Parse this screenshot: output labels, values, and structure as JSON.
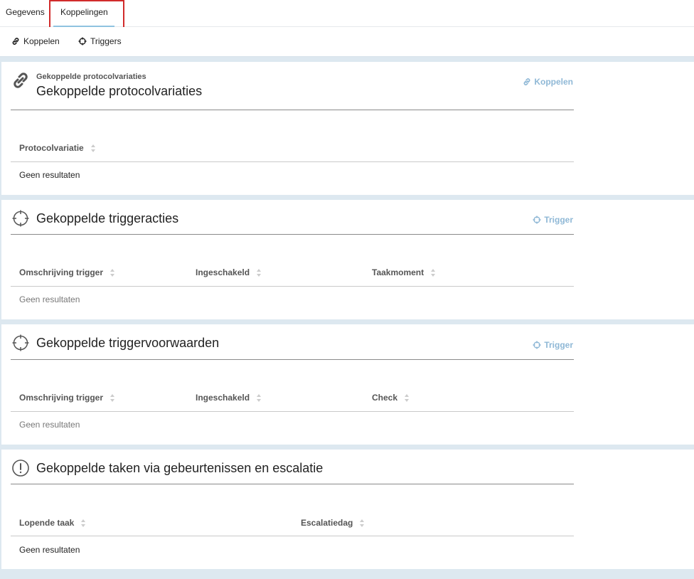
{
  "tabs": {
    "gegevens": "Gegevens",
    "koppelingen": "Koppelingen"
  },
  "toolbar": {
    "koppelen": "Koppelen",
    "triggers": "Triggers"
  },
  "panels": {
    "protocol": {
      "subtitle": "Gekoppelde protocolvariaties",
      "title": "Gekoppelde protocolvariaties",
      "action": "Koppelen",
      "columns": [
        "Protocolvariatie"
      ],
      "empty": "Geen resultaten"
    },
    "triggeracties": {
      "title": "Gekoppelde triggeracties",
      "action": "Trigger",
      "columns": [
        "Omschrijving trigger",
        "Ingeschakeld",
        "Taakmoment"
      ],
      "empty": "Geen resultaten"
    },
    "triggervoorwaarden": {
      "title": "Gekoppelde triggervoorwaarden",
      "action": "Trigger",
      "columns": [
        "Omschrijving trigger",
        "Ingeschakeld",
        "Check"
      ],
      "empty": "Geen resultaten"
    },
    "taken": {
      "title": "Gekoppelde taken via gebeurtenissen en escalatie",
      "columns": [
        "Lopende taak",
        "Escalatiedag"
      ],
      "empty": "Geen resultaten"
    }
  },
  "colors": {
    "accent": "#8fb8d6",
    "highlight_border": "#d12b2b",
    "background": "#dde8f0"
  },
  "icons": [
    "link-icon",
    "crosshair-icon",
    "exclamation-circle-icon",
    "sort-icon"
  ]
}
